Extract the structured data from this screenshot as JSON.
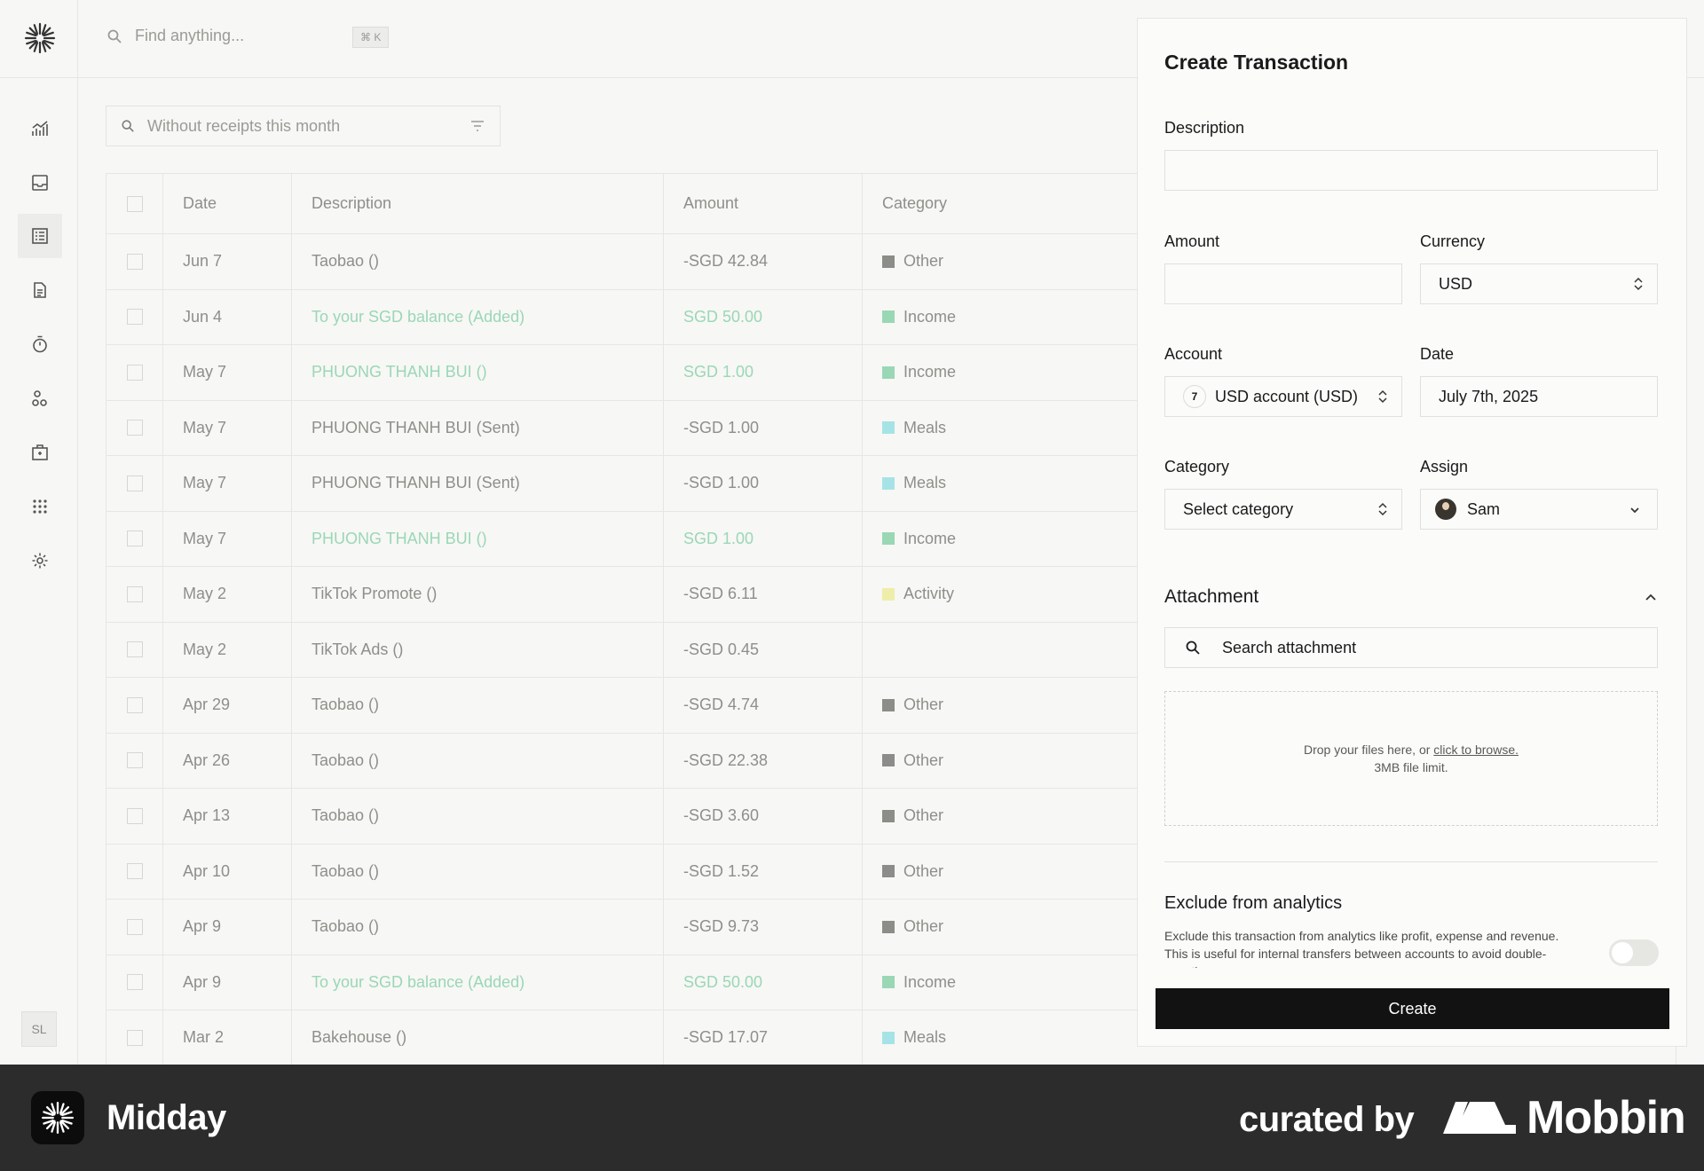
{
  "search": {
    "placeholder": "Find anything...",
    "shortcut": "⌘ K"
  },
  "filter": {
    "label": "Without receipts this month"
  },
  "table": {
    "headers": {
      "date": "Date",
      "description": "Description",
      "amount": "Amount",
      "category": "Category"
    },
    "rows": [
      {
        "date": "Jun 7",
        "description": "Taobao ()",
        "amount": "-SGD 42.84",
        "category": "Other",
        "color": "#8c8c88",
        "income": false
      },
      {
        "date": "Jun 4",
        "description": "To your SGD balance (Added)",
        "amount": "SGD 50.00",
        "category": "Income",
        "color": "#9ad7b5",
        "income": true
      },
      {
        "date": "May 7",
        "description": "PHUONG THANH BUI ()",
        "amount": "SGD 1.00",
        "category": "Income",
        "color": "#9ad7b5",
        "income": true
      },
      {
        "date": "May 7",
        "description": "PHUONG THANH BUI (Sent)",
        "amount": "-SGD 1.00",
        "category": "Meals",
        "color": "#a6e3e6",
        "income": false
      },
      {
        "date": "May 7",
        "description": "PHUONG THANH BUI (Sent)",
        "amount": "-SGD 1.00",
        "category": "Meals",
        "color": "#a6e3e6",
        "income": false
      },
      {
        "date": "May 7",
        "description": "PHUONG THANH BUI ()",
        "amount": "SGD 1.00",
        "category": "Income",
        "color": "#9ad7b5",
        "income": true
      },
      {
        "date": "May 2",
        "description": "TikTok Promote ()",
        "amount": "-SGD 6.11",
        "category": "Activity",
        "color": "#eeeeaa",
        "income": false
      },
      {
        "date": "May 2",
        "description": "TikTok Ads ()",
        "amount": "-SGD 0.45",
        "category": "",
        "color": "",
        "income": false
      },
      {
        "date": "Apr 29",
        "description": "Taobao ()",
        "amount": "-SGD 4.74",
        "category": "Other",
        "color": "#8c8c88",
        "income": false
      },
      {
        "date": "Apr 26",
        "description": "Taobao ()",
        "amount": "-SGD 22.38",
        "category": "Other",
        "color": "#8c8c88",
        "income": false
      },
      {
        "date": "Apr 13",
        "description": "Taobao ()",
        "amount": "-SGD 3.60",
        "category": "Other",
        "color": "#8c8c88",
        "income": false
      },
      {
        "date": "Apr 10",
        "description": "Taobao ()",
        "amount": "-SGD 1.52",
        "category": "Other",
        "color": "#8c8c88",
        "income": false
      },
      {
        "date": "Apr 9",
        "description": "Taobao ()",
        "amount": "-SGD 9.73",
        "category": "Other",
        "color": "#8c8c88",
        "income": false
      },
      {
        "date": "Apr 9",
        "description": "To your SGD balance (Added)",
        "amount": "SGD 50.00",
        "category": "Income",
        "color": "#9ad7b5",
        "income": true
      },
      {
        "date": "Mar 2",
        "description": "Bakehouse ()",
        "amount": "-SGD 17.07",
        "category": "Meals",
        "color": "#a6e3e6",
        "income": false
      }
    ]
  },
  "panel": {
    "title": "Create Transaction",
    "description_label": "Description",
    "description_value": "",
    "amount_label": "Amount",
    "amount_value": "",
    "currency_label": "Currency",
    "currency_value": "USD",
    "account_label": "Account",
    "account_value": "USD account (USD)",
    "account_icon": "7",
    "date_label": "Date",
    "date_value": "July 7th, 2025",
    "category_label": "Category",
    "category_value": "Select category",
    "assign_label": "Assign",
    "assign_value": "Sam",
    "attachment_title": "Attachment",
    "attachment_search_placeholder": "Search attachment",
    "drop_text": "Drop your files here, or ",
    "drop_link": "click to browse.",
    "drop_limit": "3MB file limit.",
    "exclude_title": "Exclude from analytics",
    "exclude_desc": "Exclude this transaction from analytics like profit, expense and revenue. This is useful for internal transfers between accounts to avoid double-counting.",
    "create_label": "Create"
  },
  "sidebar": {
    "user_initials": "SL"
  },
  "footer": {
    "app_name": "Midday",
    "curated_by": "curated by",
    "brand": "Mobbin"
  },
  "colors": {
    "accent": "#121212",
    "income": "#9ad7b5",
    "footer_bg": "#2c2c2c"
  }
}
